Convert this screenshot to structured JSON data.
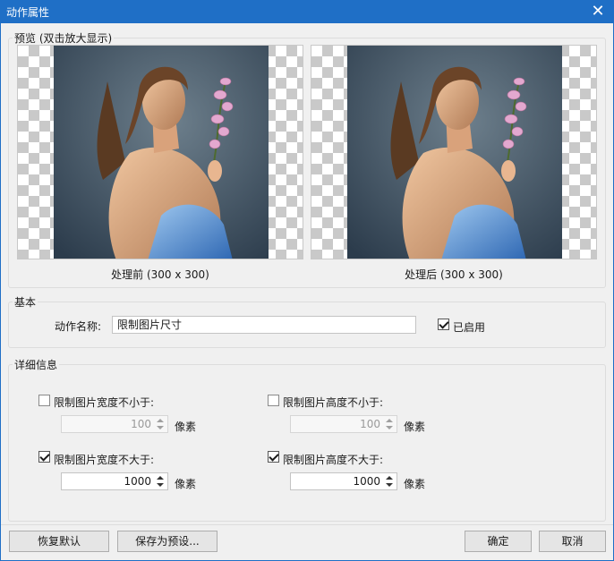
{
  "window": {
    "title": "动作属性",
    "close_icon": "close-icon",
    "title_bar_color": "#1f6fc6"
  },
  "preview": {
    "group_label": "预览 (双击放大显示)",
    "before_caption": "处理前 (300 x 300)",
    "after_caption": "处理后 (300 x 300)"
  },
  "basic": {
    "group_label": "基本",
    "action_name_label": "动作名称:",
    "action_name_value": "限制图片尺寸",
    "enabled_label": "已启用",
    "enabled_checked": true
  },
  "details": {
    "group_label": "详细信息",
    "min_width": {
      "label": "限制图片宽度不小于:",
      "checked": false,
      "value": "100",
      "unit": "像素"
    },
    "min_height": {
      "label": "限制图片高度不小于:",
      "checked": false,
      "value": "100",
      "unit": "像素"
    },
    "max_width": {
      "label": "限制图片宽度不大于:",
      "checked": true,
      "value": "1000",
      "unit": "像素"
    },
    "max_height": {
      "label": "限制图片高度不大于:",
      "checked": true,
      "value": "1000",
      "unit": "像素"
    }
  },
  "buttons": {
    "restore_default": "恢复默认",
    "save_preset": "保存为预设...",
    "ok": "确定",
    "cancel": "取消"
  }
}
